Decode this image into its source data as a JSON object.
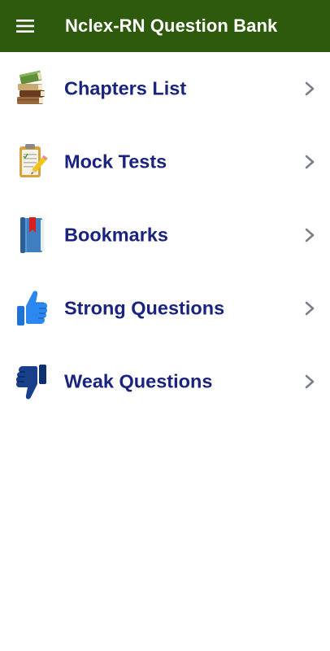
{
  "appbar": {
    "title": "Nclex-RN Question Bank",
    "background_color": "#2d5a0c",
    "menu_icon": "hamburger-menu-icon"
  },
  "menu": {
    "label_color": "#1a237e",
    "items": [
      {
        "label": "Chapters List",
        "icon": "books-stack-icon"
      },
      {
        "label": "Mock Tests",
        "icon": "clipboard-pencil-icon"
      },
      {
        "label": "Bookmarks",
        "icon": "bookmark-book-icon"
      },
      {
        "label": "Strong Questions",
        "icon": "thumbs-up-icon"
      },
      {
        "label": "Weak Questions",
        "icon": "thumbs-down-icon"
      }
    ]
  }
}
